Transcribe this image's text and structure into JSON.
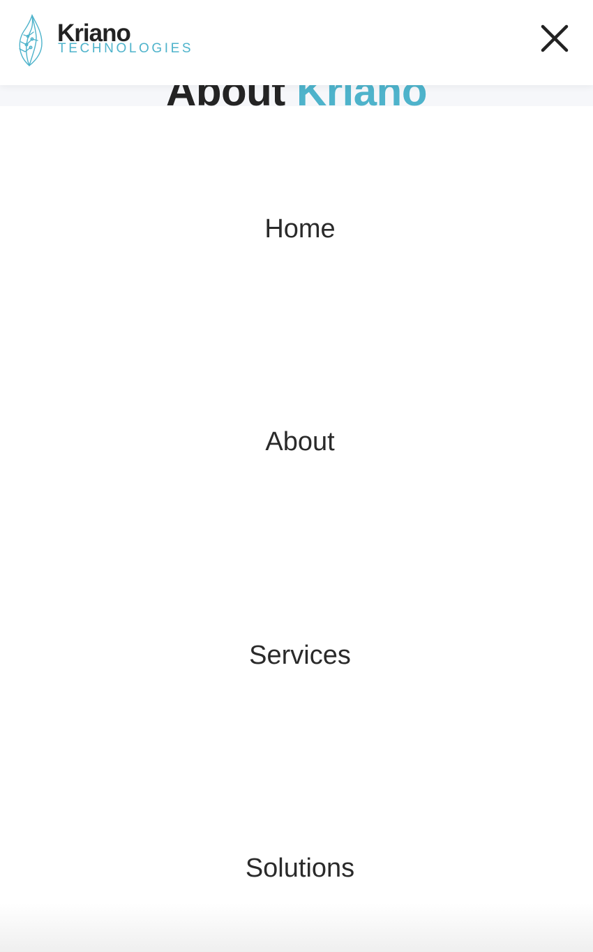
{
  "brand": {
    "name": "Kriano",
    "tagline": "TECHNOLOGIES",
    "accent_color": "#4eb3cb",
    "logo_icon": "leaf-circuit-icon"
  },
  "background_page": {
    "heading_part1": "About ",
    "heading_part2": "Kriano"
  },
  "header": {
    "close_icon": "close-icon"
  },
  "menu": {
    "items": [
      {
        "label": "Home"
      },
      {
        "label": "About"
      },
      {
        "label": "Services"
      },
      {
        "label": "Solutions"
      }
    ]
  }
}
